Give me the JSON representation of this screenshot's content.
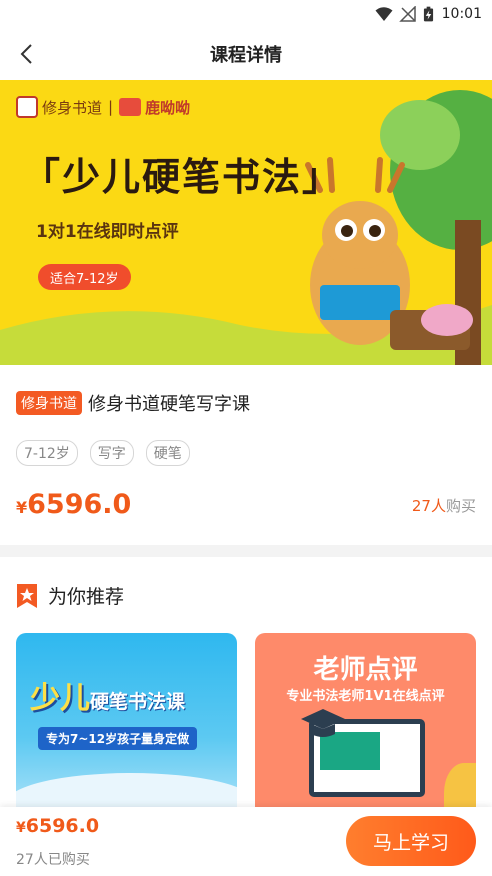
{
  "status_bar": {
    "time": "10:01"
  },
  "nav": {
    "title": "课程详情"
  },
  "banner": {
    "brand_left": "修身书道",
    "brand_right": "鹿呦呦",
    "headline": "少儿硬笔书法",
    "headline_open": "「",
    "headline_close": "」",
    "subtitle": "1对1在线即时点评",
    "age_pill": "适合7-12岁"
  },
  "course": {
    "brand_tag": "修身书道",
    "title": "修身书道硬笔写字课",
    "chips": [
      "7-12岁",
      "写字",
      "硬笔"
    ],
    "price_symbol": "¥",
    "price": "6596.0",
    "buyer_count": "27人",
    "buyer_suffix": "购买"
  },
  "recommend": {
    "section_title": "为你推荐",
    "card1": {
      "big_a": "少儿",
      "big_b": "硬笔书法课",
      "ribbon": "专为7~12岁孩子量身定做"
    },
    "card2": {
      "title": "老师点评",
      "subtitle": "专业书法老师1V1在线点评"
    }
  },
  "bottom_bar": {
    "price_symbol": "¥",
    "price": "6596.0",
    "buyers": "27人已购买",
    "cta": "马上学习"
  },
  "colors": {
    "accent": "#f05a1a",
    "banner_bg": "#fbd914",
    "card2_bg": "#fe8a6a"
  }
}
